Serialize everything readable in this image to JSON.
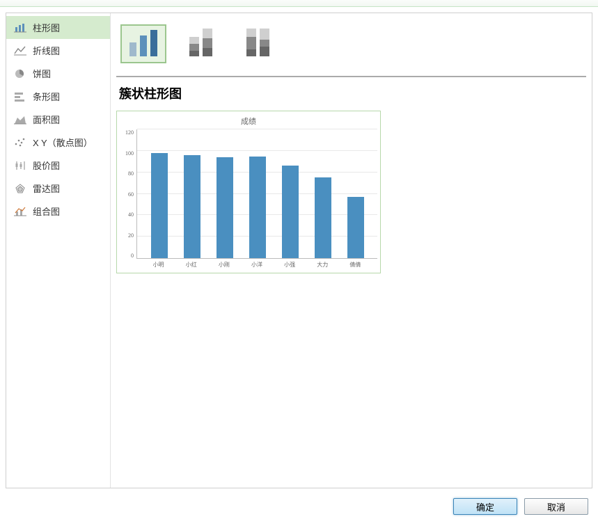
{
  "sidebar": {
    "items": [
      {
        "label": "柱形图",
        "icon": "bar-chart-icon",
        "selected": true
      },
      {
        "label": "折线图",
        "icon": "line-chart-icon",
        "selected": false
      },
      {
        "label": "饼图",
        "icon": "pie-chart-icon",
        "selected": false
      },
      {
        "label": "条形图",
        "icon": "hbar-chart-icon",
        "selected": false
      },
      {
        "label": "面积图",
        "icon": "area-chart-icon",
        "selected": false
      },
      {
        "label": "X Y（散点图）",
        "icon": "scatter-chart-icon",
        "selected": false
      },
      {
        "label": "股价图",
        "icon": "stock-chart-icon",
        "selected": false
      },
      {
        "label": "雷达图",
        "icon": "radar-chart-icon",
        "selected": false
      },
      {
        "label": "组合图",
        "icon": "combo-chart-icon",
        "selected": false
      }
    ]
  },
  "section_title": "簇状柱形图",
  "subtypes": [
    {
      "name": "clustered-column",
      "selected": true
    },
    {
      "name": "stacked-column",
      "selected": false
    },
    {
      "name": "percent-stacked-column",
      "selected": false
    }
  ],
  "footer": {
    "ok_label": "确定",
    "cancel_label": "取消"
  },
  "chart_data": {
    "type": "bar",
    "title": "成绩",
    "xlabel": "",
    "ylabel": "",
    "ylim": [
      0,
      120
    ],
    "yticks": [
      0,
      20,
      40,
      60,
      80,
      100,
      120
    ],
    "categories": [
      "小明",
      "小红",
      "小刚",
      "小洋",
      "小强",
      "大力",
      "倩倩"
    ],
    "values": [
      98,
      96,
      94,
      95,
      86,
      75,
      57
    ]
  }
}
